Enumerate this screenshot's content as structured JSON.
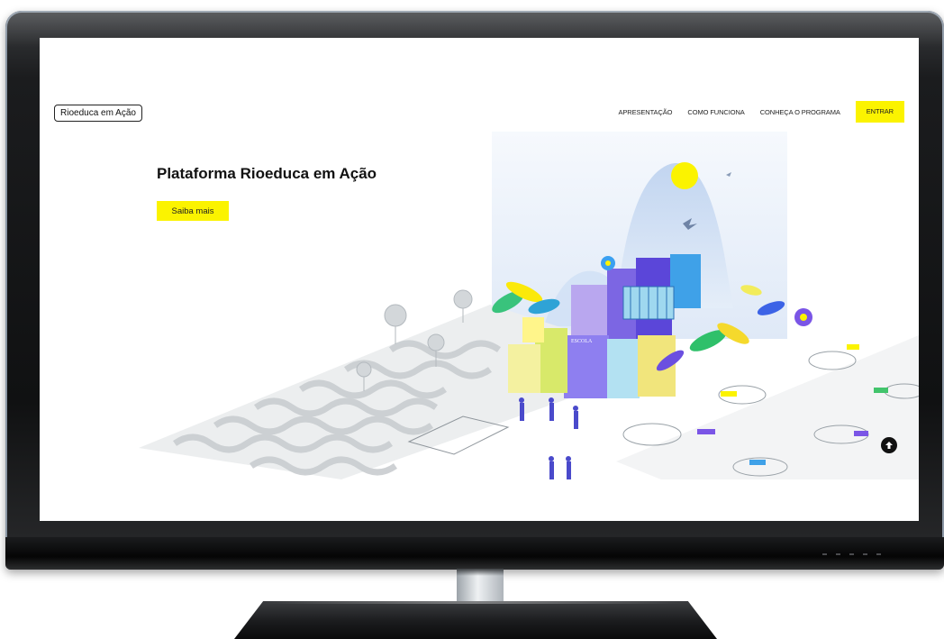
{
  "header": {
    "logo_label": "Rioeduca em Ação",
    "nav": [
      {
        "label": "APRESENTAÇÃO"
      },
      {
        "label": "COMO FUNCIONA"
      },
      {
        "label": "CONHEÇA O PROGRAMA"
      }
    ],
    "enter_label": "ENTRAR"
  },
  "hero": {
    "title": "Plataforma Rioeduca em Ação",
    "cta_label": "Saiba mais"
  },
  "illustration": {
    "sign_text": "ESCOLA"
  },
  "icons": {
    "scroll_top": "arrow-up-circle-icon"
  },
  "colors": {
    "accent_yellow": "#fbf300",
    "text_dark": "#111111"
  }
}
